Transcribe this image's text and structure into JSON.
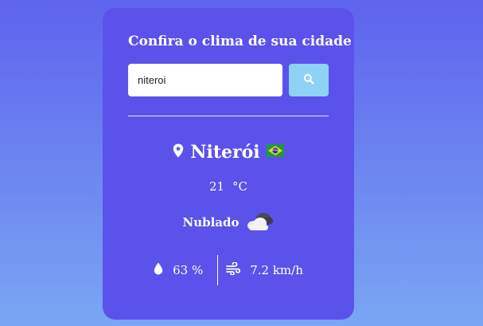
{
  "form": {
    "title": "Confira o clima de sua cidade",
    "search_value": "niteroi",
    "search_button_icon": "search-icon"
  },
  "weather": {
    "city": "Niterói",
    "country_flag": "brazil-flag-icon",
    "temperature": "21",
    "temperature_unit": "°C",
    "description": "Nublado",
    "description_icon": "cloudy-icon",
    "humidity": "63 %",
    "wind": "7.2 km/h"
  },
  "colors": {
    "card": "#5b52ec",
    "button": "#8dd3f6",
    "background_top": "#5e63ee",
    "background_bottom": "#7aa6f3"
  }
}
